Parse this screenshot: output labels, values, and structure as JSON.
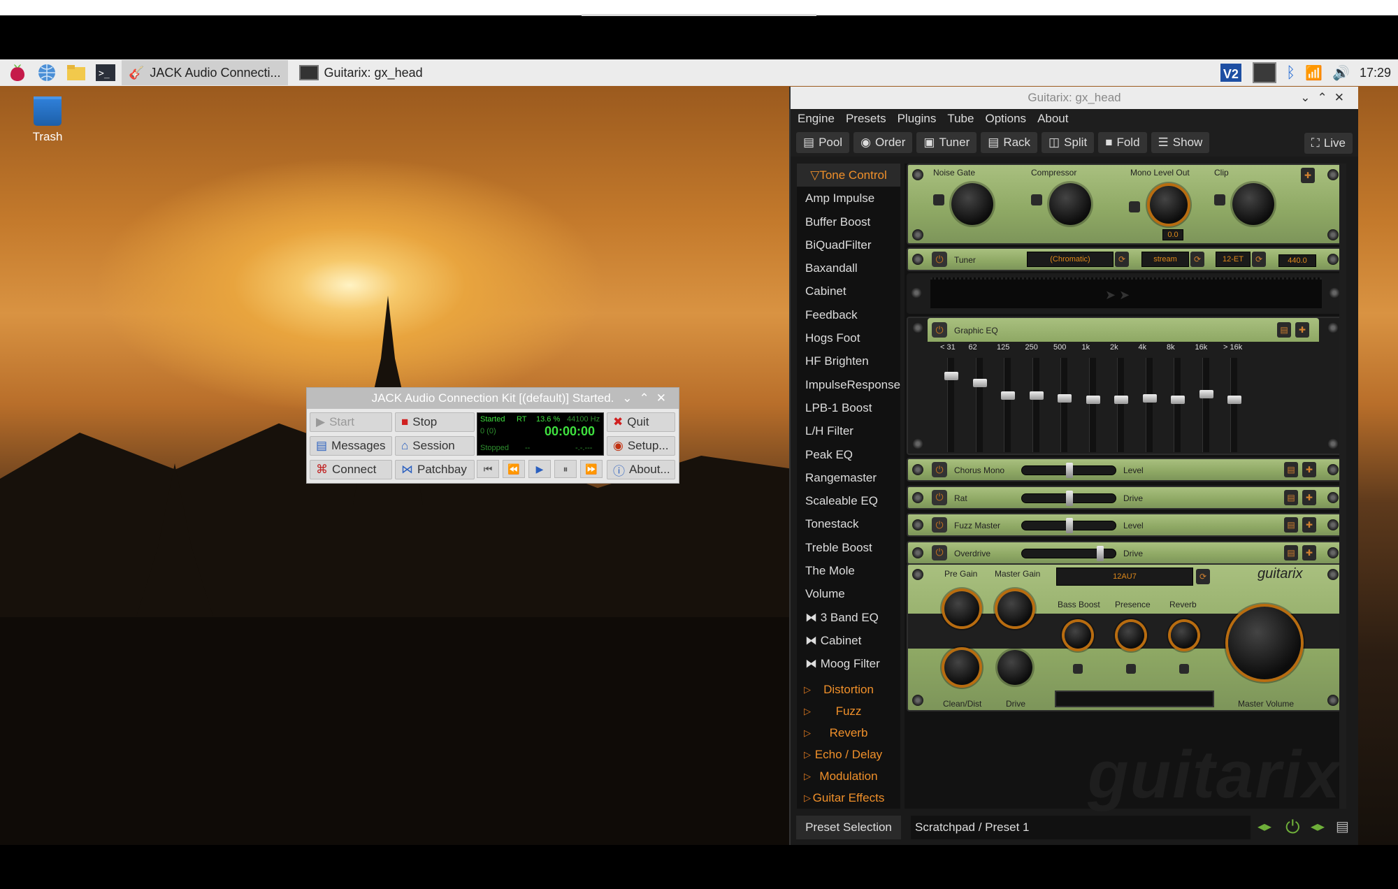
{
  "taskbar": {
    "tasks": [
      {
        "label": "JACK Audio Connecti...",
        "icon": "jack-icon"
      },
      {
        "label": "Guitarix: gx_head",
        "icon": "guitarix-icon"
      }
    ],
    "clock": "17:29"
  },
  "desktop": {
    "trash_label": "Trash"
  },
  "jack": {
    "title": "JACK Audio Connection Kit [(default)] Started.",
    "buttons": {
      "start": "Start",
      "stop": "Stop",
      "messages": "Messages",
      "session": "Session",
      "connect": "Connect",
      "patchbay": "Patchbay",
      "quit": "Quit",
      "setup": "Setup...",
      "about": "About..."
    },
    "display": {
      "status": "Started",
      "rt": "RT",
      "load": "13.6 %",
      "rate": "44100 Hz",
      "xruns": "0 (0)",
      "time": "00:00:00",
      "transport": "Stopped",
      "dash": "--",
      "bbt": "-.-.---"
    }
  },
  "guitarix": {
    "title": "Guitarix: gx_head",
    "menu": [
      "Engine",
      "Presets",
      "Plugins",
      "Tube",
      "Options",
      "About"
    ],
    "toolbar": [
      "Pool",
      "Order",
      "Tuner",
      "Rack",
      "Split",
      "Fold",
      "Show"
    ],
    "live": "Live",
    "plugin_list": {
      "open_category": "Tone Control",
      "items": [
        "Amp Impulse",
        "Buffer Boost",
        "BiQuadFilter",
        "Baxandall",
        "Cabinet",
        "Feedback",
        "Hogs Foot",
        "HF Brighten",
        "ImpulseResponse",
        "LPB-1 Boost",
        "L/H Filter",
        "Peak EQ",
        "Rangemaster",
        "Scaleable EQ",
        "Tonestack",
        "Treble Boost",
        "The Mole",
        "Volume"
      ],
      "lv2_items": [
        "3 Band EQ",
        "Cabinet",
        "Moog Filter"
      ],
      "categories": [
        "Distortion",
        "Fuzz",
        "Reverb",
        "Echo / Delay",
        "Modulation",
        "Guitar Effects"
      ]
    },
    "rack": {
      "top": {
        "labels": [
          "Noise Gate",
          "Compressor",
          "Mono Level Out",
          "Clip"
        ],
        "level": "0.0"
      },
      "tuner": {
        "name": "Tuner",
        "mode": "(Chromatic)",
        "stream": "stream",
        "temperament": "12-ET",
        "ref": "440.0"
      },
      "geq": {
        "name": "Graphic EQ",
        "bands": [
          "< 31",
          "62",
          "125",
          "250",
          "500",
          "1k",
          "2k",
          "4k",
          "8k",
          "16k",
          "> 16k"
        ]
      },
      "effects": [
        {
          "name": "Chorus Mono",
          "param": "Level",
          "value": 0.5
        },
        {
          "name": "Rat",
          "param": "Drive",
          "value": 0.5
        },
        {
          "name": "Fuzz Master",
          "param": "Level",
          "value": 0.5
        },
        {
          "name": "Overdrive",
          "param": "Drive",
          "value": 0.85
        }
      ],
      "amp": {
        "tube": "12AU7",
        "logo": "guitarix",
        "labels": [
          "Pre Gain",
          "Master Gain",
          "Bass Boost",
          "Presence",
          "Reverb",
          "Clean/Dist",
          "Drive",
          "Master Volume"
        ]
      }
    },
    "preset": {
      "button": "Preset Selection",
      "current": "Scratchpad / Preset 1"
    },
    "watermark": "guitarix"
  },
  "colors": {
    "accent": "#f0902a",
    "rack_green": "#9bb271",
    "jack_time": "#3fe13f"
  }
}
